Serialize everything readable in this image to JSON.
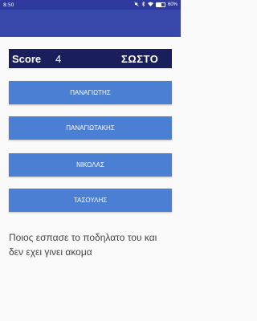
{
  "status_bar": {
    "time": "8:50",
    "battery_text": "60%",
    "battery_level": 0.6,
    "icons": [
      "silent-icon",
      "bluetooth-icon",
      "wifi-icon",
      "battery-icon"
    ]
  },
  "score": {
    "label": "Score",
    "value": "4",
    "result": "ΣΩΣΤΟ"
  },
  "answers": [
    "ΠΑΝΑΓΙΩΤΗΣ",
    "ΠΑΝΑΓΙΩΤΑΚΗΣ",
    "ΝΙΚΟΛΑΣ",
    "ΤΑΣΟΥΛΗΣ"
  ],
  "question": "Ποιος εσπασε το ποδηλατο του και δεν εχει γινει ακομα",
  "colors": {
    "status_bar": "#2e3a9e",
    "app_bar": "#3949ab",
    "score_bar": "#1a1f5c",
    "button": "#4a7fd4"
  }
}
